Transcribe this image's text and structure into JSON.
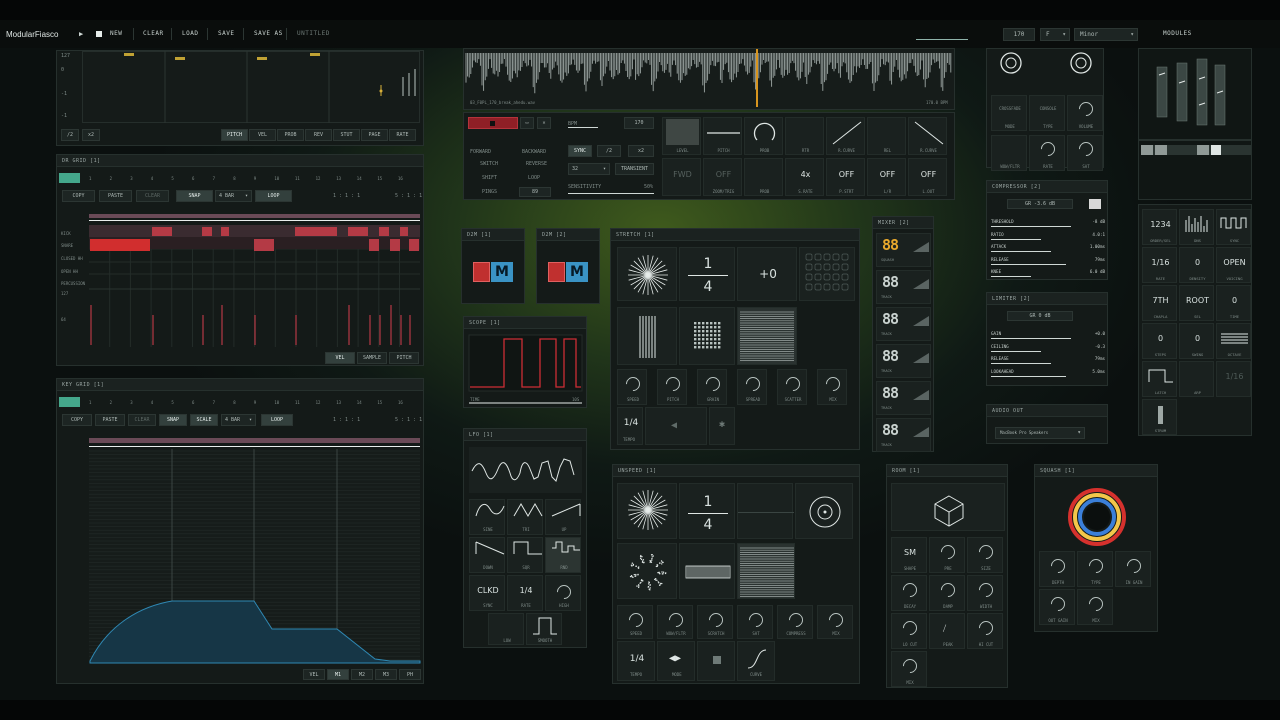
{
  "app": {
    "title": "ModularFiasco",
    "project": "UNTITLED"
  },
  "toolbar": {
    "new": "NEW",
    "clear": "CLEAR",
    "load": "LOAD",
    "save": "SAVE",
    "save_as": "SAVE AS",
    "modules": "MODULES"
  },
  "transport": {
    "bpm": "170",
    "key": "F",
    "scale": "Minor"
  },
  "top_left": {
    "labels": [
      "127",
      "0",
      "-1",
      "-1"
    ],
    "buttons": [
      "/2",
      "x2"
    ],
    "tabs": [
      "PITCH",
      "VEL",
      "PROB",
      "REV",
      "STUT",
      "PAGE",
      "RATE"
    ],
    "active_tab": "PITCH"
  },
  "dr_grid": {
    "title": "DR GRID [1]",
    "steps": [
      "1",
      "2",
      "3",
      "4",
      "5",
      "6",
      "7",
      "8",
      "9",
      "10",
      "11",
      "12",
      "13",
      "14",
      "15",
      "16"
    ],
    "buttons": {
      "copy": "COPY",
      "paste": "PASTE",
      "clear": "CLEAR",
      "snap": "SNAP",
      "length": "4 BAR",
      "loop": "LOOP",
      "pos1": "1 : 1 : 1",
      "pos2": "5 : 1 : 1"
    },
    "rows": [
      "KICK",
      "SNARE",
      "CLOSED HH",
      "OPEN HH",
      "PERCUSSION"
    ],
    "vel_labels": [
      "127",
      "64"
    ],
    "tabs": [
      "VEL",
      "SAMPLE",
      "PITCH"
    ],
    "active_tab": "VEL"
  },
  "key_grid": {
    "title": "KEY GRID [1]",
    "steps": [
      "1",
      "2",
      "3",
      "4",
      "5",
      "6",
      "7",
      "8",
      "9",
      "10",
      "11",
      "12",
      "13",
      "14",
      "15",
      "16"
    ],
    "buttons": {
      "copy": "COPY",
      "paste": "PASTE",
      "clear": "CLEAR",
      "snap": "SNAP",
      "scale": "SCALE",
      "length": "4 BAR",
      "loop": "LOOP",
      "pos1": "1 : 1 : 1",
      "pos2": "5 : 1 : 1"
    },
    "tabs": [
      "VEL",
      "M1",
      "M2",
      "M3",
      "PH"
    ],
    "active_tab": "M1"
  },
  "waveform": {
    "file": "03_F0PL_170_break_ahedu.wav",
    "info": "170.0 BPM"
  },
  "sampler": {
    "bpm_label": "BPM",
    "bpm_value": "170",
    "modes": [
      "FORWARD",
      "BACKWARD",
      "SWITCH",
      "REVERSE",
      "SHIFT",
      "LOOP",
      "PINGS",
      "89"
    ],
    "sync": "SYNC",
    "half": "/2",
    "double": "x2",
    "div": "32",
    "transient": "TRANSIENT",
    "sensitivity": "SENSITIVITY",
    "sensitivity_value": "50%",
    "controls": [
      "LEVEL",
      "PITCH",
      "PROB",
      "RTR",
      "R.CURVE",
      "REL",
      "R.CURVE"
    ],
    "row2": [
      "FWD",
      "OFF",
      "",
      "4x",
      "OFF",
      "OFF",
      "OFF"
    ],
    "row2_labels": [
      "",
      "ZOOM/TRIG",
      "PROB",
      "S.RATE",
      "P.STRT",
      "L/R",
      "L.OUT"
    ]
  },
  "d2m1": {
    "title": "D2M [1]",
    "logo": "LM"
  },
  "d2m2": {
    "title": "D2M [2]",
    "logo": "LM"
  },
  "scope": {
    "title": "SCOPE [1]",
    "time": "TIME",
    "time_value": "10S"
  },
  "lfo": {
    "title": "LFO [1]",
    "shapes": [
      "SINE",
      "TRI",
      "UP",
      "DOWN",
      "SQR",
      "RND"
    ],
    "row3": [
      {
        "value": "CLKD",
        "label": "SYNC"
      },
      {
        "value": "1/4",
        "label": "RATE"
      },
      {
        "value": "",
        "label": "HIGH"
      }
    ],
    "row4": [
      "LOW",
      "SMOOTH"
    ]
  },
  "stretch": {
    "title": "STRETCH [1]",
    "fraction_top": "1",
    "fraction_bottom": "4",
    "offset": "+0",
    "knobs": [
      "SPEED",
      "PITCH",
      "GRAIN",
      "SPREAD",
      "SCATTER",
      "MIX"
    ],
    "tempo_value": "1/4",
    "tempo": "TEMPO"
  },
  "unspeed": {
    "title": "UNSPEED [1]",
    "fraction_top": "1",
    "fraction_bottom": "4",
    "knobs": [
      "SPEED",
      "WOW/FLTR",
      "SCRATCH",
      "SAT",
      "COMPRESS",
      "MIX"
    ],
    "tempo_value": "1/4",
    "tempo": "TEMPO",
    "mode": "MODE",
    "curve": "CURVE"
  },
  "mixer": {
    "title": "MIXER [2]",
    "channels": [
      "88",
      "88",
      "88",
      "88",
      "88",
      "88"
    ],
    "labels": [
      "SQUASH",
      "TRACK",
      "TRACK",
      "TRACK",
      "TRACK",
      "TRACK"
    ]
  },
  "mangle": {
    "labels": [
      "CROSSFADE",
      "CONSOLE",
      "MODE",
      "TYPE",
      "VOLUME",
      "WOW/FLTR",
      "RATE",
      "SAT"
    ]
  },
  "compressor": {
    "title": "COMPRESSOR [2]",
    "gr": "GR -3.6 dB",
    "params": [
      {
        "k": "THRESHOLD",
        "v": "-8 dB"
      },
      {
        "k": "RATIO",
        "v": "4.0:1"
      },
      {
        "k": "ATTACK",
        "v": "1.00ms"
      },
      {
        "k": "RELEASE",
        "v": "79ms"
      },
      {
        "k": "KNEE",
        "v": "6.0 dB"
      }
    ]
  },
  "limiter": {
    "title": "LIMITER [2]",
    "gr": "GR 0 dB",
    "params": [
      {
        "k": "GAIN",
        "v": "+0.0"
      },
      {
        "k": "CEILING",
        "v": "-0.3"
      },
      {
        "k": "RELEASE",
        "v": "79ms"
      },
      {
        "k": "LOOKAHEAD",
        "v": "5.0ms"
      }
    ]
  },
  "audio_out": {
    "title": "AUDIO OUT",
    "device": "MacBook Pro Speakers"
  },
  "room": {
    "title": "ROOM [1]",
    "size_value": "SM",
    "labels": [
      "SHAPE",
      "PRE",
      "SIZE",
      "DECAY",
      "DAMP",
      "WIDTH",
      "LO CUT",
      "PEAK",
      "HI CUT",
      "MIX"
    ]
  },
  "squash": {
    "title": "SQUASH [1]",
    "labels": [
      "DEPTH",
      "TYPE",
      "IN GAIN",
      "OUT GAIN",
      "MIX"
    ]
  },
  "arp": {
    "values": [
      "1234",
      "",
      "",
      "1/16",
      "0",
      "OPEN",
      "7TH",
      "ROOT",
      "0",
      "0",
      "0",
      ""
    ],
    "labels": [
      "ORDER/SEL",
      "DNS",
      "SYNC",
      "RATE",
      "DENSITY",
      "VOICING",
      "CHAPLA",
      "SEL",
      "TIME",
      "STEPS",
      "SWING",
      "OCTAVE",
      "LATCH",
      "ARP",
      "",
      "STRUM"
    ],
    "dim_value": "1/16"
  }
}
